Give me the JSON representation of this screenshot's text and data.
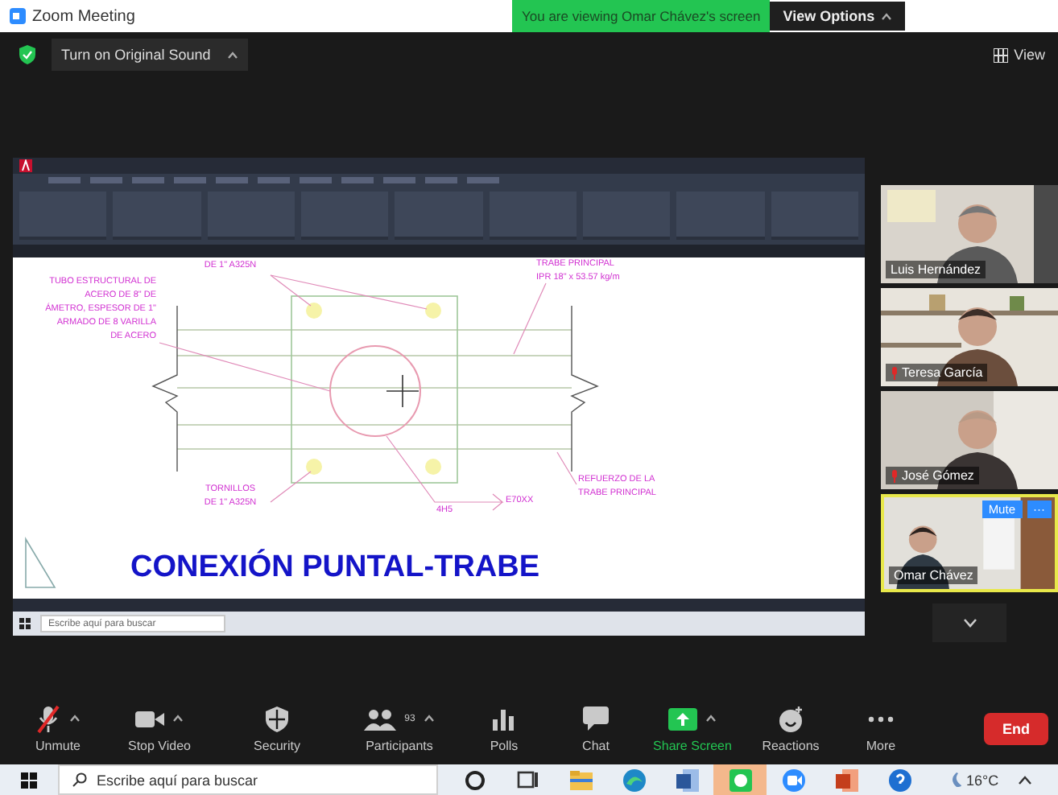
{
  "window": {
    "title": "Zoom Meeting"
  },
  "banner": {
    "text": "You are viewing Omar Chávez's screen"
  },
  "view_options": {
    "label": "View Options"
  },
  "top_bar": {
    "original_sound": "Turn on Original Sound",
    "view": "View"
  },
  "shared_screen": {
    "annotations": [
      {
        "lines": [
          "DE 1\" A325N"
        ]
      },
      {
        "lines": [
          "TUBO ESTRUCTURAL DE",
          "ACERO DE 8\" DE",
          "ÁMETRO, ESPESOR DE 1\"",
          "ARMADO DE 8 VARILLA",
          "DE ACERO"
        ]
      },
      {
        "lines": [
          "TRABE PRINCIPAL",
          "IPR 18\" x 53.57 kg/m"
        ]
      },
      {
        "lines": [
          "TORNILLOS",
          "DE 1\" A325N"
        ]
      },
      {
        "lines": [
          "REFUERZO DE LA",
          "TRABE PRINCIPAL"
        ]
      },
      {
        "lines": [
          "4H5"
        ]
      },
      {
        "lines": [
          "E70XX"
        ]
      }
    ],
    "title": "CONEXIÓN PUNTAL-TRABE",
    "taskbar_search": "Escribe aquí para buscar"
  },
  "participants": [
    {
      "name": "Luis Hernández",
      "muted": false,
      "highlighted": false
    },
    {
      "name": "Teresa García",
      "muted": true,
      "highlighted": false
    },
    {
      "name": "José Gómez",
      "muted": true,
      "highlighted": false
    },
    {
      "name": "Omar Chávez",
      "muted": false,
      "highlighted": true,
      "buttons": [
        "Mute",
        "···"
      ]
    }
  ],
  "toolbar": [
    {
      "label": "Unmute",
      "muted": true,
      "active": false,
      "menu": true
    },
    {
      "label": "Stop Video",
      "active": false,
      "menu": true
    },
    {
      "label": "Security",
      "active": false,
      "menu": false
    },
    {
      "label": "Participants",
      "count": "93",
      "active": false,
      "menu": true
    },
    {
      "label": "Polls",
      "active": false,
      "menu": false
    },
    {
      "label": "Chat",
      "active": false,
      "menu": false
    },
    {
      "label": "Share Screen",
      "active": true,
      "menu": true
    },
    {
      "label": "Reactions",
      "active": false,
      "menu": false
    },
    {
      "label": "More",
      "active": false,
      "menu": false
    }
  ],
  "end_button": "End",
  "taskbar": {
    "search": "Escribe aquí para buscar",
    "apps": [
      {
        "selected": false
      },
      {
        "selected": false
      },
      {
        "selected": false
      },
      {
        "selected": false
      },
      {
        "selected": false
      },
      {
        "selected": true
      },
      {
        "selected": false
      },
      {
        "selected": false
      },
      {
        "selected": false
      }
    ],
    "weather": "16°C"
  }
}
